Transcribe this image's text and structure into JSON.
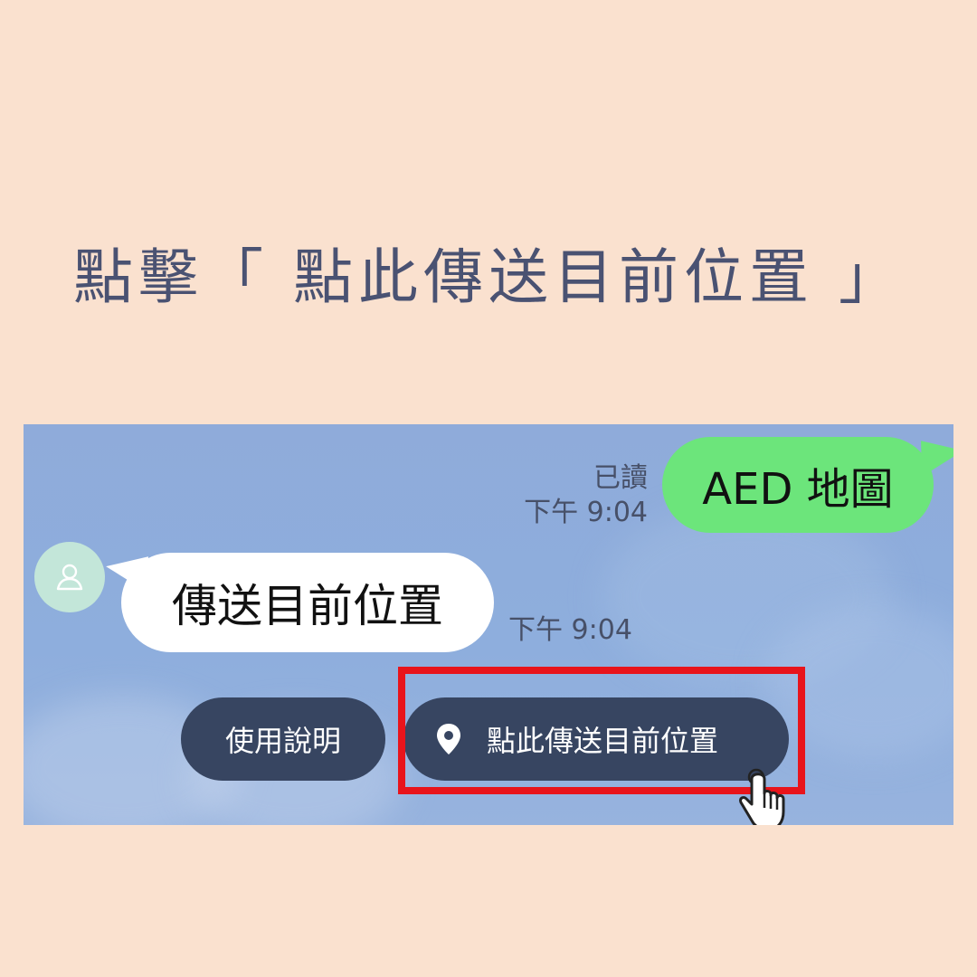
{
  "heading": "點擊「 點此傳送目前位置 」",
  "chat": {
    "sent_message": "AED 地圖",
    "read_status": "已讀",
    "sent_time": "下午 9:04",
    "received_message": "傳送目前位置",
    "received_time": "下午 9:04",
    "quick_replies": {
      "help_label": "使用說明",
      "location_label": "點此傳送目前位置"
    }
  },
  "icons": {
    "avatar": "person-icon",
    "location": "map-pin-icon",
    "cursor": "hand-pointer-icon"
  },
  "colors": {
    "page_background": "#fae1cf",
    "heading": "#4a5272",
    "sent_bubble": "#6ce57b",
    "received_bubble": "#ffffff",
    "quick_reply": "#374561",
    "highlight": "#e8141b",
    "avatar": "#c3e6d9"
  }
}
